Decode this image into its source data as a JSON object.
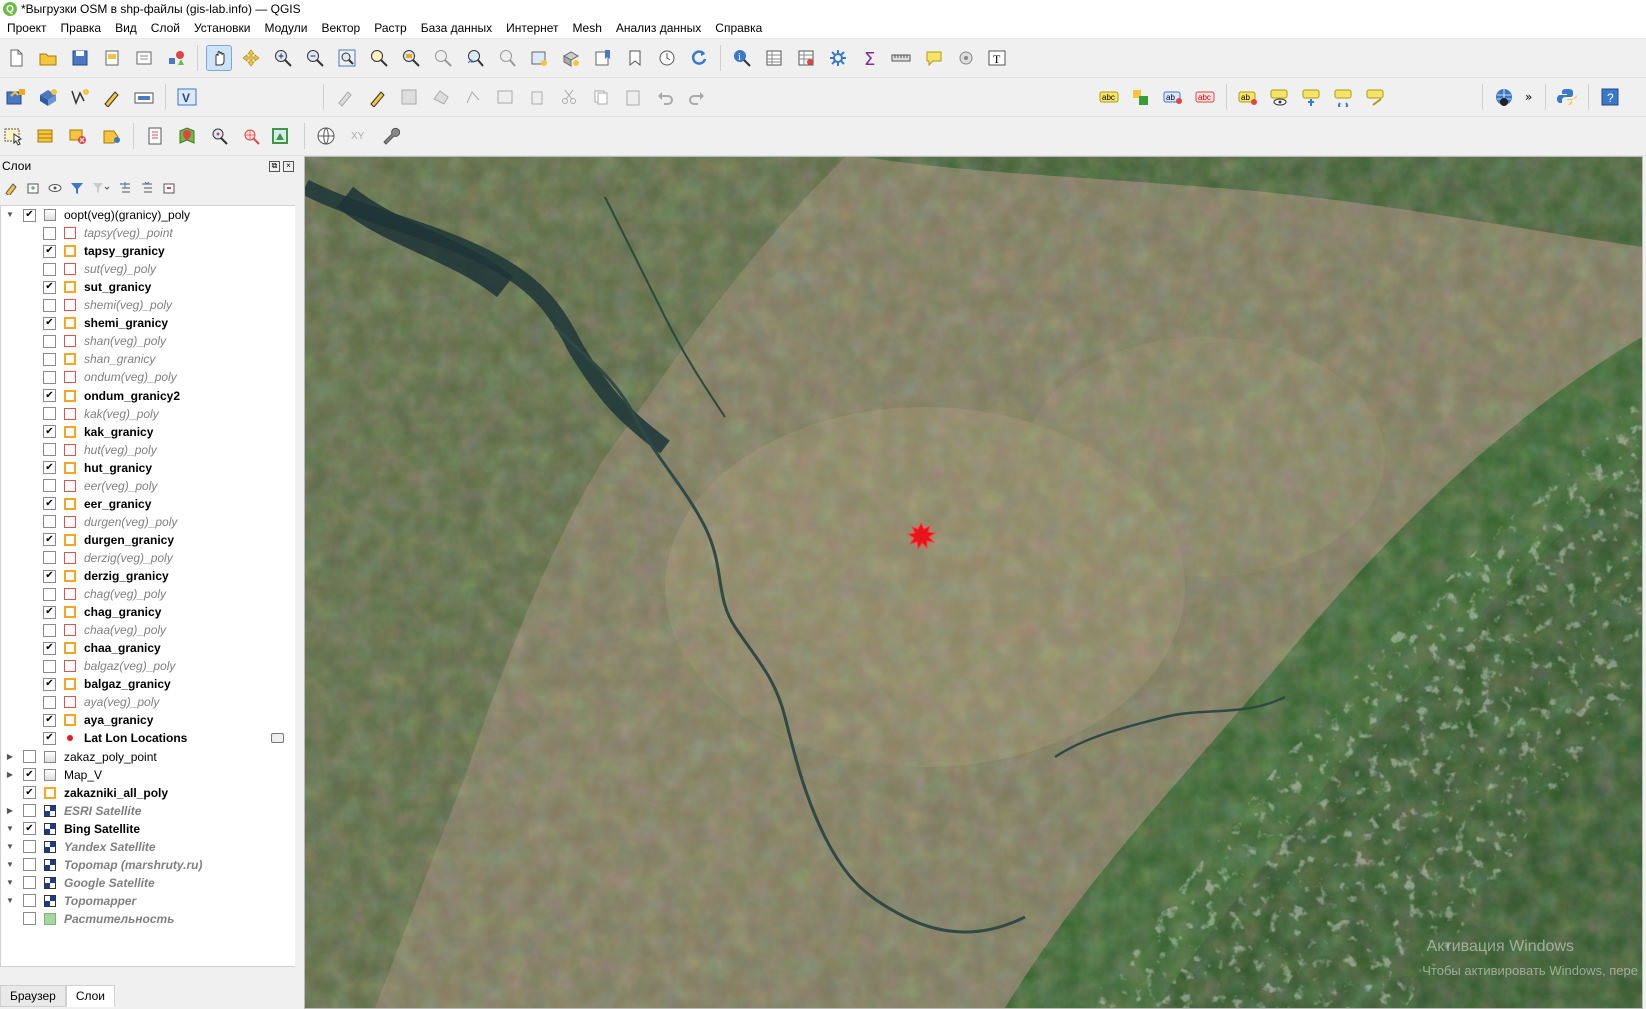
{
  "window": {
    "title": "*Выгрузки OSM в shp-файлы (gis-lab.info) — QGIS"
  },
  "menu": [
    "Проект",
    "Правка",
    "Вид",
    "Слой",
    "Установки",
    "Модули",
    "Вектор",
    "Растр",
    "База данных",
    "Интернет",
    "Mesh",
    "Анализ данных",
    "Справка"
  ],
  "layers_panel": {
    "title": "Слои",
    "items": [
      {
        "label": "oopt(veg)(granicy)_poly",
        "level": 0,
        "checked": true,
        "style": "normal",
        "symbol": "grp",
        "expand": "open"
      },
      {
        "label": "tapsy(veg)_point",
        "level": 1,
        "checked": false,
        "style": "italic",
        "symbol": "polyred"
      },
      {
        "label": "tapsy_granicy",
        "level": 1,
        "checked": true,
        "style": "bold",
        "symbol": "poly"
      },
      {
        "label": "sut(veg)_poly",
        "level": 1,
        "checked": false,
        "style": "italic",
        "symbol": "polyred"
      },
      {
        "label": "sut_granicy",
        "level": 1,
        "checked": true,
        "style": "bold",
        "symbol": "poly"
      },
      {
        "label": "shemi(veg)_poly",
        "level": 1,
        "checked": false,
        "style": "italic",
        "symbol": "polyred"
      },
      {
        "label": "shemi_granicy",
        "level": 1,
        "checked": true,
        "style": "bold",
        "symbol": "poly"
      },
      {
        "label": "shan(veg)_poly",
        "level": 1,
        "checked": false,
        "style": "italic",
        "symbol": "polyred"
      },
      {
        "label": "shan_granicy",
        "level": 1,
        "checked": false,
        "style": "italic",
        "symbol": "poly"
      },
      {
        "label": "ondum(veg)_poly",
        "level": 1,
        "checked": false,
        "style": "italic",
        "symbol": "polyred"
      },
      {
        "label": "ondum_granicy2",
        "level": 1,
        "checked": true,
        "style": "bold",
        "symbol": "poly"
      },
      {
        "label": "kak(veg)_poly",
        "level": 1,
        "checked": false,
        "style": "italic",
        "symbol": "polyred"
      },
      {
        "label": "kak_granicy",
        "level": 1,
        "checked": true,
        "style": "bold",
        "symbol": "poly"
      },
      {
        "label": "hut(veg)_poly",
        "level": 1,
        "checked": false,
        "style": "italic",
        "symbol": "polyred"
      },
      {
        "label": "hut_granicy",
        "level": 1,
        "checked": true,
        "style": "bold",
        "symbol": "poly"
      },
      {
        "label": "eer(veg)_poly",
        "level": 1,
        "checked": false,
        "style": "italic",
        "symbol": "polyred"
      },
      {
        "label": "eer_granicy",
        "level": 1,
        "checked": true,
        "style": "bold",
        "symbol": "poly"
      },
      {
        "label": "durgen(veg)_poly",
        "level": 1,
        "checked": false,
        "style": "italic",
        "symbol": "polyred"
      },
      {
        "label": "durgen_granicy",
        "level": 1,
        "checked": true,
        "style": "bold",
        "symbol": "poly"
      },
      {
        "label": "derzig(veg)_poly",
        "level": 1,
        "checked": false,
        "style": "italic",
        "symbol": "polyred"
      },
      {
        "label": "derzig_granicy",
        "level": 1,
        "checked": true,
        "style": "bold",
        "symbol": "poly"
      },
      {
        "label": "chag(veg)_poly",
        "level": 1,
        "checked": false,
        "style": "italic",
        "symbol": "polyred"
      },
      {
        "label": "chag_granicy",
        "level": 1,
        "checked": true,
        "style": "bold",
        "symbol": "poly"
      },
      {
        "label": "chaa(veg)_poly",
        "level": 1,
        "checked": false,
        "style": "italic",
        "symbol": "polyred"
      },
      {
        "label": "chaa_granicy",
        "level": 1,
        "checked": true,
        "style": "bold",
        "symbol": "poly"
      },
      {
        "label": "balgaz(veg)_poly",
        "level": 1,
        "checked": false,
        "style": "italic",
        "symbol": "polyred"
      },
      {
        "label": "balgaz_granicy",
        "level": 1,
        "checked": true,
        "style": "bold",
        "symbol": "poly"
      },
      {
        "label": "aya(veg)_poly",
        "level": 1,
        "checked": false,
        "style": "italic",
        "symbol": "polyred"
      },
      {
        "label": "aya_granicy",
        "level": 1,
        "checked": true,
        "style": "bold",
        "symbol": "poly"
      },
      {
        "label": "Lat Lon Locations",
        "level": 1,
        "checked": true,
        "style": "bold",
        "symbol": "pt"
      },
      {
        "label": "zakaz_poly_point",
        "level": 0,
        "checked": false,
        "style": "normal",
        "symbol": "grp",
        "expand": "closed"
      },
      {
        "label": "Map_V",
        "level": 0,
        "checked": true,
        "style": "normal",
        "symbol": "grp",
        "expand": "closed"
      },
      {
        "label": "zakazniki_all_poly",
        "level": 0,
        "checked": true,
        "style": "bold",
        "symbol": "poly"
      },
      {
        "label": "ESRI Satellite",
        "level": 0,
        "checked": false,
        "style": "bolditalic",
        "symbol": "ras",
        "expand": "closed"
      },
      {
        "label": "Bing Satellite",
        "level": 0,
        "checked": true,
        "style": "bold",
        "symbol": "ras",
        "expand": "open"
      },
      {
        "label": "Yandex Satellite",
        "level": 0,
        "checked": false,
        "style": "bolditalic",
        "symbol": "ras",
        "expand": "open"
      },
      {
        "label": "Topomap (marshruty.ru)",
        "level": 0,
        "checked": false,
        "style": "bolditalic",
        "symbol": "ras",
        "expand": "open"
      },
      {
        "label": "Google Satellite",
        "level": 0,
        "checked": false,
        "style": "bolditalic",
        "symbol": "ras",
        "expand": "open"
      },
      {
        "label": "Topomapper",
        "level": 0,
        "checked": false,
        "style": "bolditalic",
        "symbol": "ras",
        "expand": "open"
      },
      {
        "label": "Растительность",
        "level": 0,
        "checked": false,
        "style": "bolditalic",
        "symbol": "green"
      }
    ]
  },
  "bottom_tabs": [
    "Браузер",
    "Слои"
  ],
  "watermark": {
    "line1": "Активация Windows",
    "line2": "Чтобы активировать Windows, пере"
  },
  "colors": {
    "accent": "#6bbd46",
    "marker": "#e8141a",
    "poly_outline": "#f5a623"
  }
}
